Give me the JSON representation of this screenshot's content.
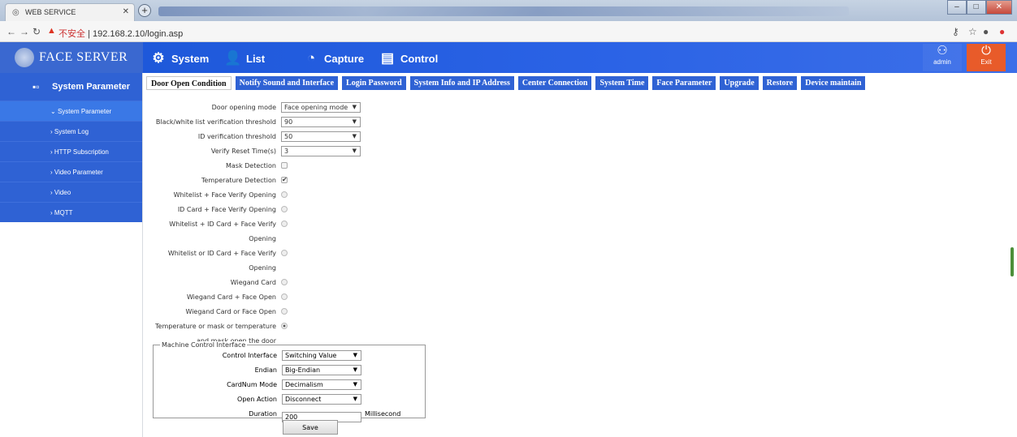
{
  "browser": {
    "tab_title": "WEB SERVICE",
    "not_secure": "不安全",
    "url": "192.168.2.10/login.asp"
  },
  "header": {
    "logo_text": "FACE SERVER",
    "menu": [
      "System",
      "List",
      "Capture",
      "Control"
    ],
    "admin": "admin",
    "exit": "Exit"
  },
  "sidebar": {
    "title": "System Parameter",
    "items": [
      "System Parameter",
      "System Log",
      "HTTP Subscription",
      "Video Parameter",
      "Video",
      "MQTT"
    ]
  },
  "tabs": [
    "Door Open Condition",
    "Notify Sound and Interface",
    "Login Password",
    "System Info and IP Address",
    "Center Connection",
    "System Time",
    "Face Parameter",
    "Upgrade",
    "Restore",
    "Device maintain"
  ],
  "form": {
    "door_mode_label": "Door opening mode",
    "door_mode_value": "Face opening mode",
    "bw_label": "Black/white list verification threshold",
    "bw_value": "90",
    "id_label": "ID verification threshold",
    "id_value": "50",
    "reset_label": "Verify Reset Time(s)",
    "reset_value": "3",
    "mask_label": "Mask Detection",
    "temp_label": "Temperature Detection",
    "radio1": "Whitelist + Face Verify Opening",
    "radio2": "ID Card + Face Verify Opening",
    "radio3a": "Whitelist + ID Card + Face Verify",
    "radio3b": "Opening",
    "radio4a": "Whitelist or ID Card + Face Verify",
    "radio4b": "Opening",
    "radio5": "Wiegand Card",
    "radio6": "Wiegand Card + Face Open",
    "radio7": "Wiegand Card or Face Open",
    "radio8a": "Temperature or mask or temperature",
    "radio8b": "and mask open the door"
  },
  "machine": {
    "legend": "Machine Control Interface",
    "control_label": "Control Interface",
    "control_value": "Switching Value",
    "endian_label": "Endian",
    "endian_value": "Big-Endian",
    "cardnum_label": "CardNum Mode",
    "cardnum_value": "Decimalism",
    "action_label": "Open Action",
    "action_value": "Disconnect",
    "duration_label": "Duration",
    "duration_value": "200",
    "duration_unit": "Millisecond"
  },
  "save_label": "Save"
}
